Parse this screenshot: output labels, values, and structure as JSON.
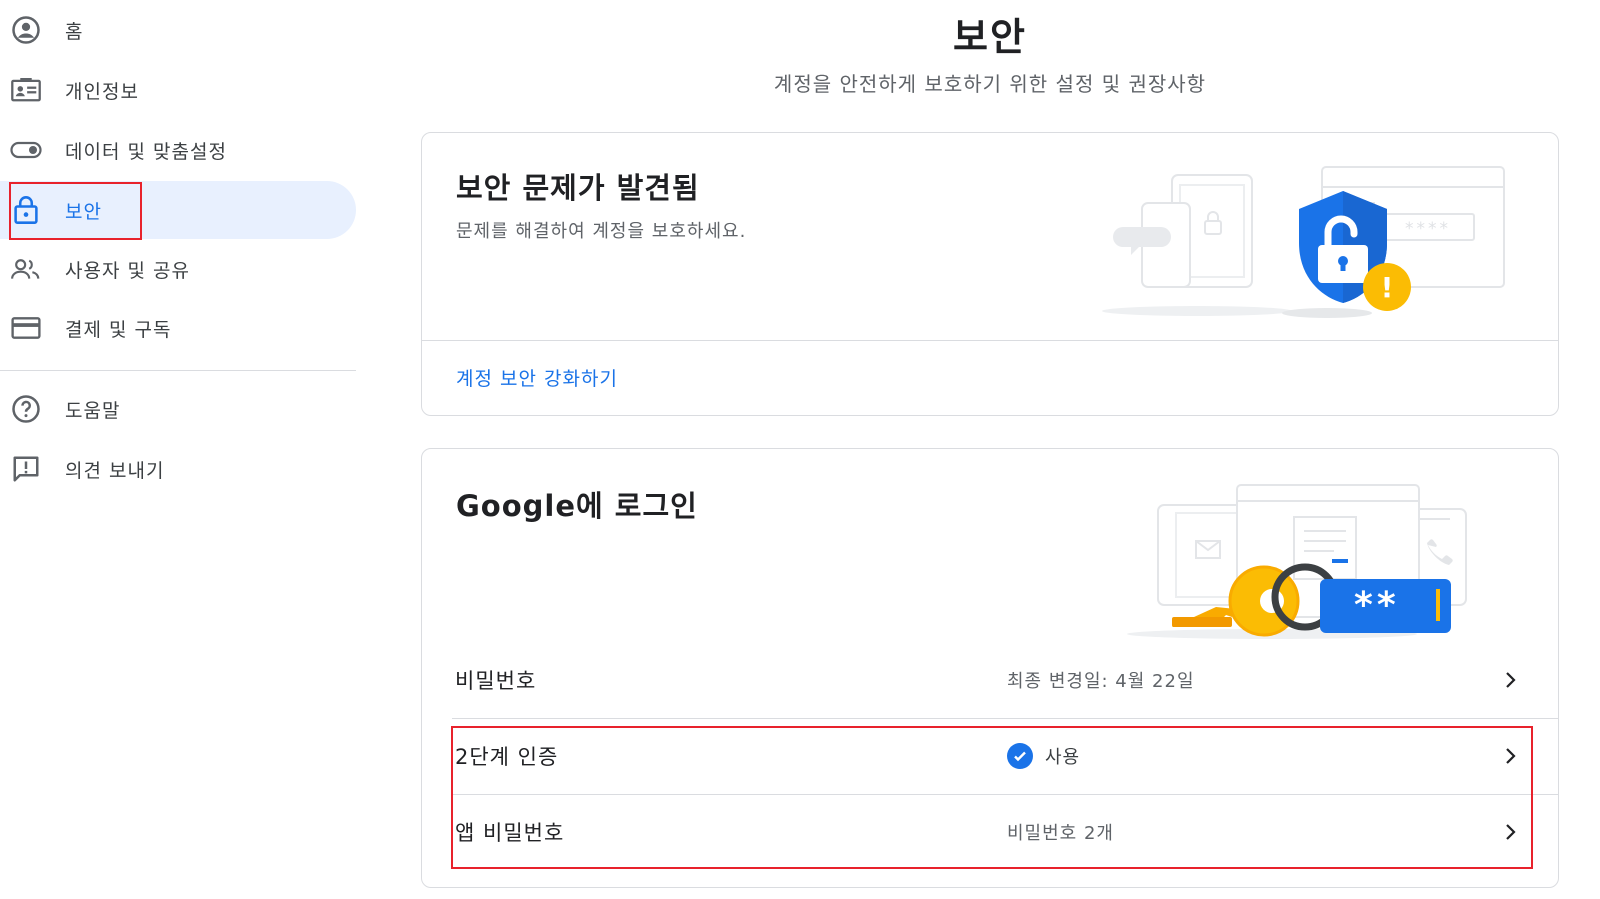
{
  "sidebar": {
    "items": [
      {
        "label": "홈",
        "icon": "account-circle-icon"
      },
      {
        "label": "개인정보",
        "icon": "id-card-icon"
      },
      {
        "label": "데이터 및 맞춤설정",
        "icon": "toggle-icon"
      },
      {
        "label": "보안",
        "icon": "lock-icon",
        "active": true
      },
      {
        "label": "사용자 및 공유",
        "icon": "people-icon"
      },
      {
        "label": "결제 및 구독",
        "icon": "credit-card-icon"
      }
    ],
    "secondary": [
      {
        "label": "도움말",
        "icon": "help-icon"
      },
      {
        "label": "의견 보내기",
        "icon": "feedback-icon"
      }
    ]
  },
  "header": {
    "title": "보안",
    "subtitle": "계정을 안전하게 보호하기 위한 설정 및 권장사항"
  },
  "issues_card": {
    "title": "보안 문제가 발견됨",
    "description": "문제를 해결하여 계정을 보호하세요.",
    "link": "계정 보안 강화하기",
    "password_mask": "****",
    "alert_glyph": "!"
  },
  "signin_card": {
    "title": "Google에 로그인",
    "password_mask": "**",
    "rows": [
      {
        "label": "비밀번호",
        "value": "최종 변경일: 4월 22일"
      },
      {
        "label": "2단계 인증",
        "value": "사용",
        "status_icon": "check-circle-icon"
      },
      {
        "label": "앱 비밀번호",
        "value": "비밀번호 2개"
      }
    ]
  },
  "colors": {
    "accent": "#1a73e8",
    "active_bg": "#e8f0fe",
    "highlight": "#e8222c",
    "warning": "#fbbc04"
  }
}
